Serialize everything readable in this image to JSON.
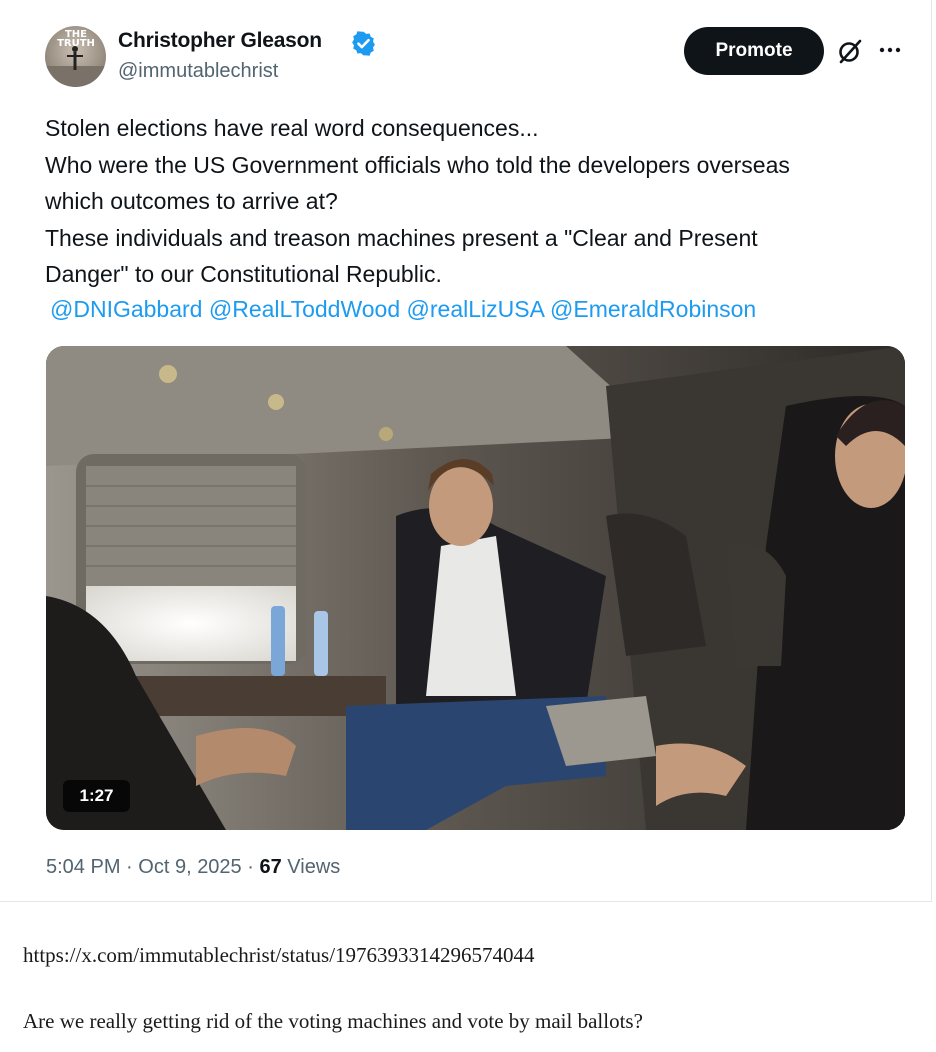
{
  "tweet": {
    "author": {
      "display_name": "Christopher Gleason",
      "handle": "@immutablechrist",
      "avatar_text": "THE TRUTH",
      "verified": true
    },
    "actions": {
      "promote_label": "Promote",
      "grok_icon": "grok-icon",
      "more_icon": "more-icon"
    },
    "text_lines": [
      "Stolen elections have real word consequences...",
      "Who were the US Government officials who told the developers overseas",
      "which outcomes to arrive at?",
      "These individuals and treason machines present a \"Clear and Present",
      "Danger\" to our Constitutional Republic."
    ],
    "mentions": [
      "@DNIGabbard",
      "@RealLToddWood",
      "@realLizUSA",
      "@EmeraldRobinson"
    ],
    "video": {
      "duration": "1:27"
    },
    "meta": {
      "time": "5:04 PM",
      "separator": "·",
      "date": "Oct 9, 2025",
      "views_count": "67",
      "views_label": "Views"
    }
  },
  "article": {
    "url": "https://x.com/immutablechrist/status/1976393314296574044",
    "question": "Are we really getting rid of the voting machines and vote by mail ballots?"
  },
  "colors": {
    "link": "#1d9bf0",
    "text": "#0f1419",
    "muted": "#536471",
    "button": "#0f1419"
  }
}
